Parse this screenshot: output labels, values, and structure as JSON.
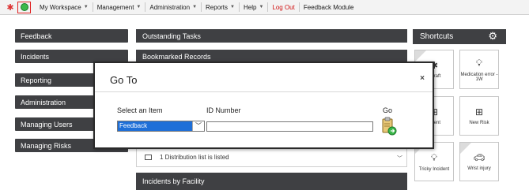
{
  "toolbar": {
    "icons": [
      "logo-icon",
      "go-to-icon"
    ],
    "items": [
      {
        "label": "My Workspace",
        "caret": true
      },
      {
        "label": "Management",
        "caret": true
      },
      {
        "label": "Administration",
        "caret": true
      },
      {
        "label": "Reports",
        "caret": true
      },
      {
        "label": "Help",
        "caret": true
      },
      {
        "label": "Log Out",
        "caret": false
      },
      {
        "label": "Feedback Module",
        "caret": false
      }
    ],
    "logout_color": "#d01010"
  },
  "nav": {
    "items": [
      "Feedback",
      "Incidents",
      "Reporting",
      "Administration",
      "Managing Users",
      "Managing Risks"
    ]
  },
  "center": {
    "outstanding_tasks": "Outstanding Tasks",
    "bookmarked_records": "Bookmarked Records",
    "distribution_text": "1 Distribution list is listed",
    "incidents_by_facility": "Incidents by Facility"
  },
  "shortcuts": {
    "title": "Shortcuts",
    "tiles": [
      {
        "label": "y draft",
        "icon": "star-icon"
      },
      {
        "label": "Medication error - 1W",
        "icon": "lightbulb-icon"
      },
      {
        "label": "cident",
        "icon": "plus-box-icon"
      },
      {
        "label": "New Risk",
        "icon": "plus-box-icon"
      },
      {
        "label": "Tricky Incident",
        "icon": "lightbulb-icon"
      },
      {
        "label": "Wrist injury",
        "icon": "car-icon"
      }
    ]
  },
  "modal": {
    "title": "Go To",
    "close": "×",
    "select_label": "Select an Item",
    "id_label": "ID Number",
    "go_label": "Go",
    "selected_item": "Feedback",
    "id_value": ""
  },
  "colors": {
    "nav_bg": "#3f4043",
    "select_highlight": "#1e6fd8",
    "go_highlight_border": "#e02020"
  }
}
